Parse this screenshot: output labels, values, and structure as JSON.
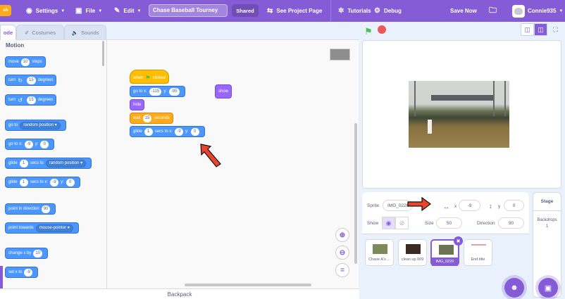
{
  "menubar": {
    "logo": "ch",
    "settings": "Settings",
    "file": "File",
    "edit": "Edit",
    "project_title": "Chase Baseball Tourney",
    "shared": "Shared",
    "see_project": "See Project Page",
    "tutorials": "Tutorials",
    "debug": "Debug",
    "save_now": "Save Now",
    "username": "Connie935"
  },
  "tabs": {
    "code": "ode",
    "costumes": "Costumes",
    "sounds": "Sounds"
  },
  "palette": {
    "category": "Motion",
    "move": {
      "a": "move",
      "n": "10",
      "b": "steps"
    },
    "turn_right": {
      "a": "turn",
      "n": "15",
      "b": "degrees"
    },
    "turn_left": {
      "a": "turn",
      "n": "15",
      "b": "degrees"
    },
    "goto": {
      "a": "go to",
      "dd": "random position"
    },
    "goto_xy": {
      "a": "go to x:",
      "x": "-9",
      "b": "y:",
      "y": "0"
    },
    "glide_random": {
      "a": "glide",
      "n": "1",
      "b": "secs to",
      "dd": "random position"
    },
    "glide_xy": {
      "a": "glide",
      "n": "1",
      "b": "secs to x:",
      "x": "-9",
      "c": "y:",
      "y": "0"
    },
    "point_dir": {
      "a": "point in direction",
      "n": "90"
    },
    "point_towards": {
      "a": "point towards",
      "dd": "mouse-pointer"
    },
    "change_x": {
      "a": "change x by",
      "n": "10"
    },
    "set_x": {
      "a": "set x to",
      "n": "-9"
    }
  },
  "script": {
    "when_flag": {
      "a": "when",
      "b": "clicked"
    },
    "goto_xy": {
      "a": "go to x:",
      "x": "-115",
      "b": "y:",
      "y": "-95"
    },
    "hide": "hide",
    "wait": {
      "n": "15",
      "b": "seconds",
      "a": "wait"
    },
    "glide": {
      "a": "glide",
      "n": "1",
      "b": "secs to x:",
      "x": "-9",
      "c": "y:",
      "y": "0"
    },
    "show": "show"
  },
  "backpack": "Backpack",
  "sprite_info": {
    "sprite_label": "Sprite",
    "sprite_name": "IMG_0226",
    "x_label": "x",
    "x_value": "-9",
    "y_label": "y",
    "y_value": "0",
    "show_label": "Show",
    "size_label": "Size",
    "size_value": "50",
    "direction_label": "Direction",
    "direction_value": "90"
  },
  "sprites": [
    {
      "name": "Chase A's ...",
      "color": "#7c8a5a"
    },
    {
      "name": "clean up 009",
      "color": "#3a2a22"
    },
    {
      "name": "IMG_0226",
      "color": "#6d7456"
    },
    {
      "name": "End title",
      "color": "#ffffff"
    }
  ],
  "stage_panel": {
    "title": "Stage",
    "backdrops_label": "Backdrops",
    "backdrops_count": "1"
  }
}
